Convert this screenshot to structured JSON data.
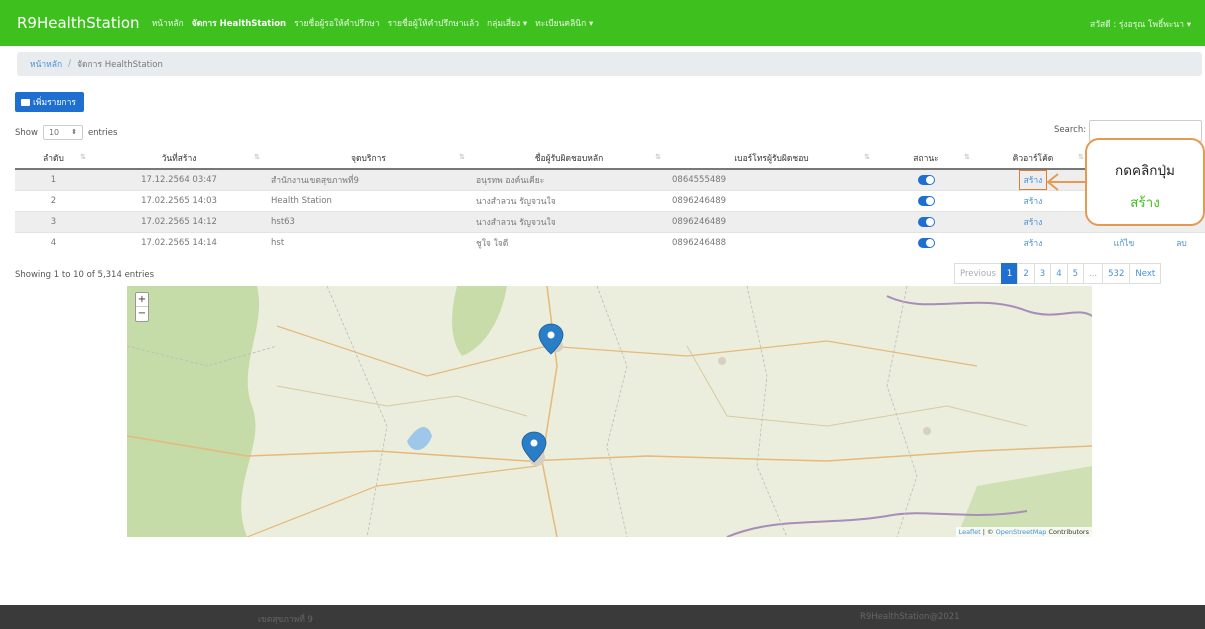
{
  "nav": {
    "brand": "R9HealthStation",
    "links": [
      "หน้าหลัก",
      "จัดการ HealthStation",
      "รายชื่อผู้รอให้คำปรึกษา",
      "รายชื่อผู้ให้คำปรึกษาแล้ว",
      "กลุ่มเสี่ยง ▾",
      "ทะเบียนคลินิก ▾"
    ],
    "user": "สวัสดี : รุ่งอรุณ โพธิ์พะนา ▾"
  },
  "breadcrumb": {
    "home": "หน้าหลัก",
    "sep": "/",
    "current": "จัดการ HealthStation"
  },
  "toolbar": {
    "add_label": "เพิ่มรายการ"
  },
  "length": {
    "show": "Show",
    "value": "10",
    "entries": "entries"
  },
  "search": {
    "label": "Search:"
  },
  "table": {
    "headers": [
      "ลำดับ",
      "วันที่สร้าง",
      "จุดบริการ",
      "ชื่อผู้รับผิดชอบหลัก",
      "เบอร์โทรผู้รับผิดชอบ",
      "สถานะ",
      "คิวอาร์โค้ด",
      "",
      ""
    ],
    "rows": [
      {
        "no": "1",
        "date": "17.12.2564 03:47",
        "place": "สำนักงานเขตสุขภาพที่9",
        "owner": "อนุรทพ องค์นเคียะ",
        "phone": "0864555489",
        "qr": "สร้าง",
        "edit": "",
        "del": ""
      },
      {
        "no": "2",
        "date": "17.02.2565 14:03",
        "place": "Health Station",
        "owner": "นางสำลวน รัญจวนใจ",
        "phone": "0896246489",
        "qr": "สร้าง",
        "edit": "",
        "del": ""
      },
      {
        "no": "3",
        "date": "17.02.2565 14:12",
        "place": "hst63",
        "owner": "นางสำลวน รัญจวนใจ",
        "phone": "0896246489",
        "qr": "สร้าง",
        "edit": "",
        "del": ""
      },
      {
        "no": "4",
        "date": "17.02.2565 14:14",
        "place": "hst",
        "owner": "ชูใจ ใจดี",
        "phone": "0896246488",
        "qr": "สร้าง",
        "edit": "แก้ไข",
        "del": "ลบ"
      }
    ]
  },
  "info": "Showing 1 to 10 of 5,314 entries",
  "pagination": [
    "Previous",
    "1",
    "2",
    "3",
    "4",
    "5",
    "...",
    "532",
    "Next"
  ],
  "map": {
    "zoom_in": "+",
    "zoom_out": "−",
    "attr_leaflet": "Leaflet",
    "attr_sep": " | © ",
    "attr_osm": "OpenStreetMap",
    "attr_tail": " Contributors"
  },
  "callout": {
    "line1": "กดคลิกปุ่ม",
    "line2": "สร้าง"
  },
  "footer": {
    "left": "เขตสุขภาพที่ 9",
    "right": "R9HealthStation@2021"
  },
  "colors": {
    "nav": "#3ec11e",
    "primary": "#1f6fd1",
    "highlight": "#e07e2e"
  }
}
